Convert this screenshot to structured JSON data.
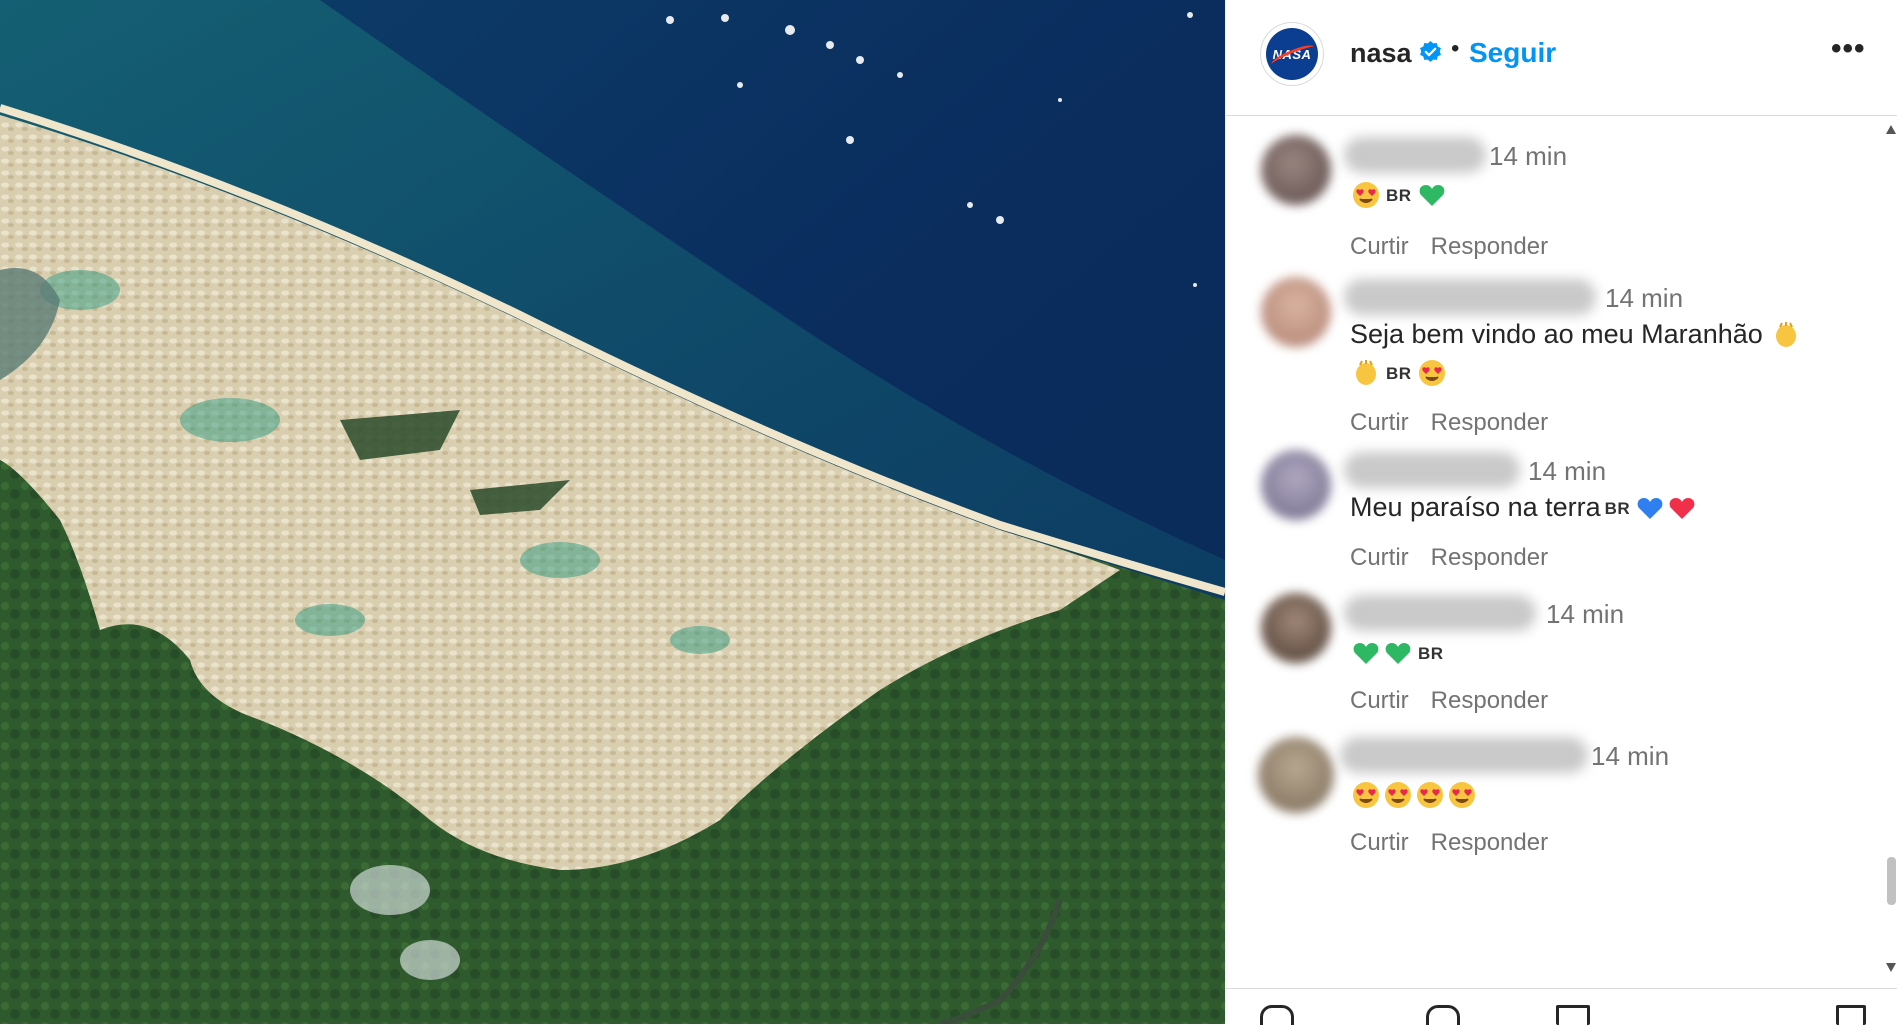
{
  "post": {
    "image_description": "",
    "account": {
      "username": "nasa",
      "verified_icon": "verified-badge-icon",
      "separator": "•",
      "follow_label": "Seguir",
      "more_label": "•••"
    }
  },
  "comments": [
    {
      "time": "14 min",
      "badge": "BR",
      "emojis": [
        "heart-eyes",
        "BR",
        "green-heart"
      ],
      "like_label": "Curtir",
      "reply_label": "Responder"
    },
    {
      "time": "14 min",
      "text_line1": "Seja bem vindo ao meu Maranhão",
      "badge": "BR",
      "emojis": [
        "clap",
        "clap",
        "BR",
        "heart-eyes"
      ],
      "like_label": "Curtir",
      "reply_label": "Responder"
    },
    {
      "time": "14 min",
      "text_line1": "Meu paraíso na terra",
      "badge": "BR",
      "emojis": [
        "BR",
        "blue-heart",
        "red-heart"
      ],
      "like_label": "Curtir",
      "reply_label": "Responder"
    },
    {
      "time": "14 min",
      "badge": "BR",
      "emojis": [
        "green-heart",
        "green-heart",
        "BR"
      ],
      "like_label": "Curtir",
      "reply_label": "Responder"
    },
    {
      "time": "14 min",
      "emojis": [
        "heart-eyes",
        "heart-eyes",
        "heart-eyes",
        "heart-eyes"
      ],
      "like_label": "Curtir",
      "reply_label": "Responder"
    }
  ],
  "colors": {
    "follow_blue": "#0095f6",
    "text": "#262626",
    "muted": "#737373",
    "verified": "#0095f6"
  }
}
